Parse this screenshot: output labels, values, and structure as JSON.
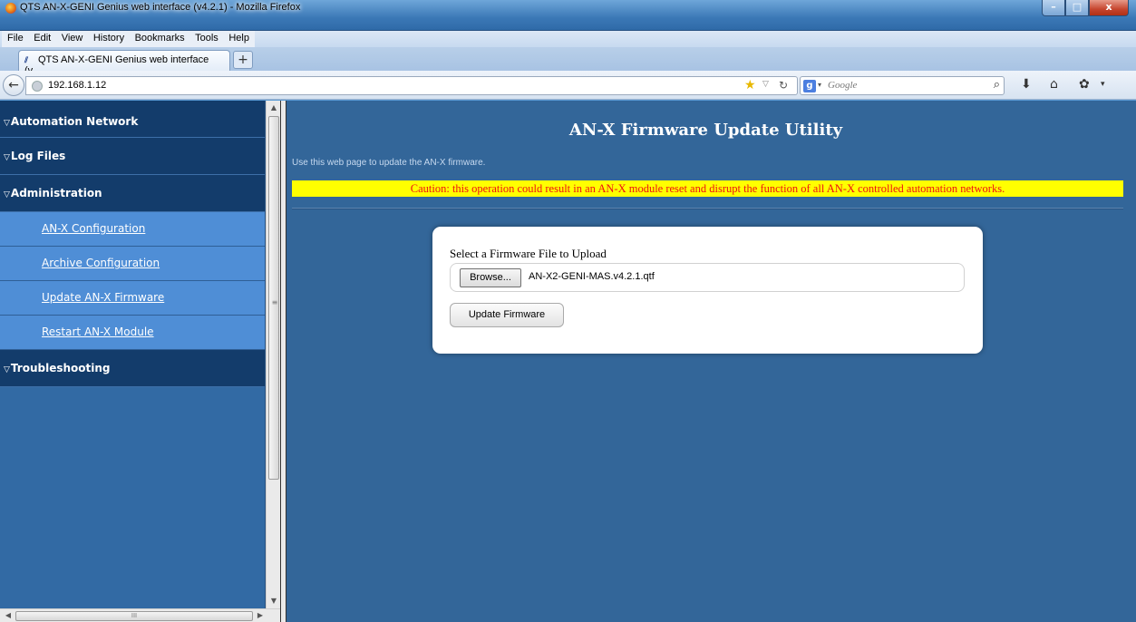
{
  "window": {
    "title": "QTS AN-X-GENI Genius web interface (v4.2.1) - Mozilla Firefox",
    "buttons": {
      "minimize": "–",
      "maximize": "□",
      "close": "x"
    }
  },
  "menubar": {
    "items": [
      "File",
      "Edit",
      "View",
      "History",
      "Bookmarks",
      "Tools",
      "Help"
    ]
  },
  "tabs": {
    "active_label": "QTS AN-X-GENI Genius web interface (v...",
    "new_tab": "+"
  },
  "navbar": {
    "back": "←",
    "url": "192.168.1.12",
    "search_placeholder": "Google",
    "icons": {
      "bookmark": "star-icon",
      "reload": "reload-icon",
      "search": "magnifier-icon",
      "downloads": "download-icon",
      "home": "home-icon"
    }
  },
  "sidebar": {
    "sections": [
      {
        "label": "Automation Network",
        "items": []
      },
      {
        "label": "Log Files",
        "items": []
      },
      {
        "label": "Administration",
        "items": [
          "AN-X Configuration",
          "Archive Configuration",
          "Update AN-X Firmware",
          "Restart AN-X Module"
        ]
      },
      {
        "label": "Troubleshooting",
        "items": []
      }
    ]
  },
  "main": {
    "title": "AN-X Firmware Update Utility",
    "intro": "Use this web page to update the AN-X firmware.",
    "caution": "Caution: this operation could result in an AN-X module reset and disrupt the function of all AN-X controlled automation networks.",
    "upload": {
      "label": "Select a Firmware File to Upload",
      "browse_label": "Browse...",
      "file_name": "AN-X2-GENI-MAS.v4.2.1.qtf",
      "submit_label": "Update Firmware"
    }
  },
  "colors": {
    "main_bg": "#336699",
    "sidebar_section_bg": "#133c6b",
    "sidebar_item_bg": "#4f8ed6",
    "caution_bg": "#ffff00",
    "caution_text": "#e11111"
  }
}
